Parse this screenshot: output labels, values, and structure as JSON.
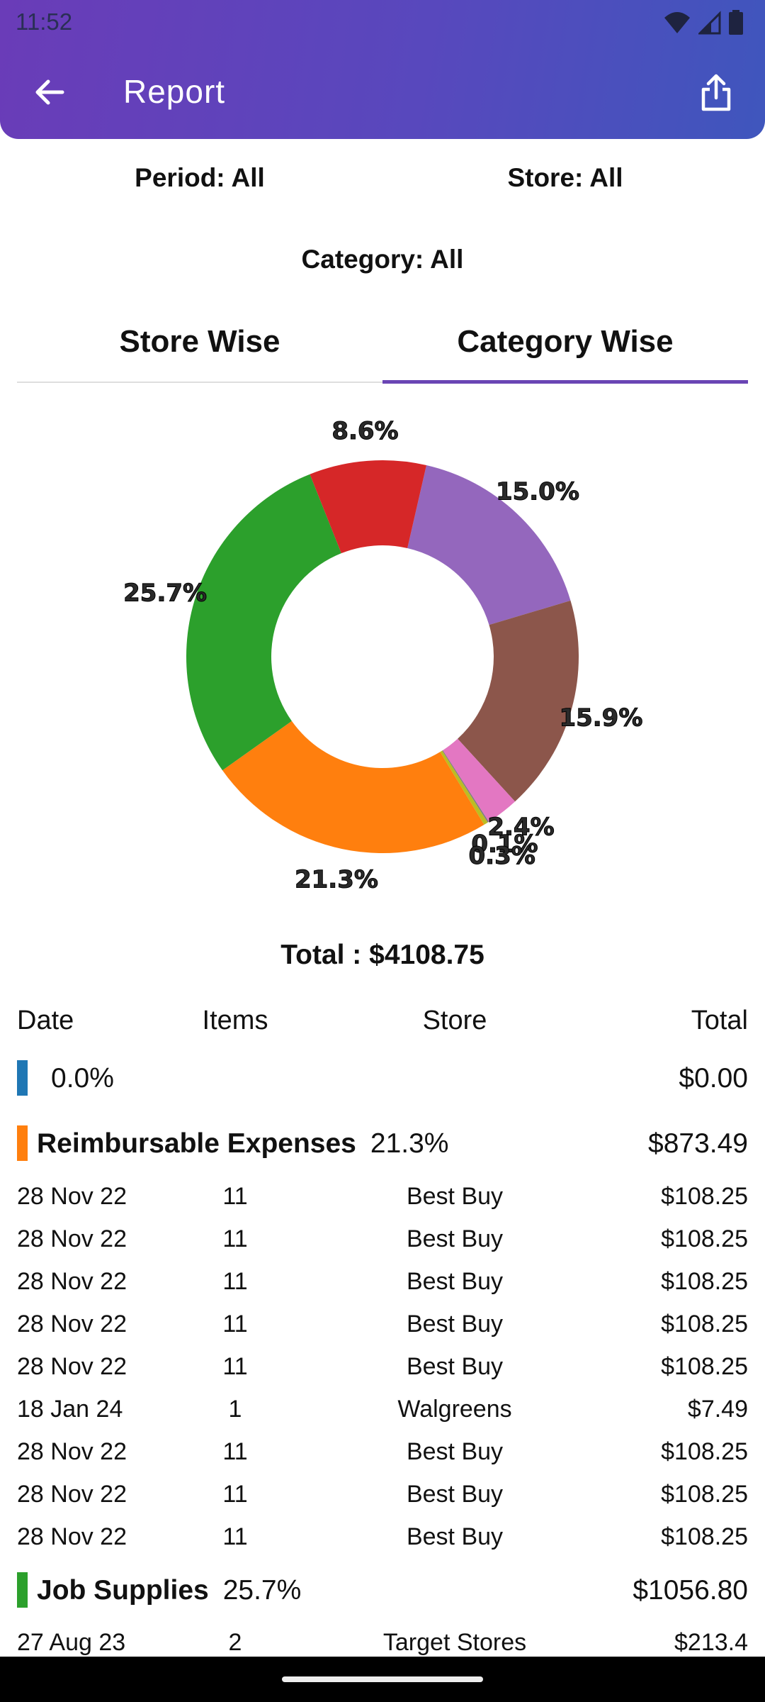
{
  "status": {
    "time": "11:52"
  },
  "toolbar": {
    "title": "Report"
  },
  "filters": {
    "period": "Period: All",
    "store": "Store: All",
    "category": "Category: All"
  },
  "tabs": [
    {
      "label": "Store Wise",
      "selected": false
    },
    {
      "label": "Category Wise",
      "selected": true
    }
  ],
  "chart_data": {
    "type": "pie",
    "donut": true,
    "slices": [
      {
        "label": "15.0%",
        "value": 15.0,
        "color": "#9467bd"
      },
      {
        "label": "15.9%",
        "value": 15.9,
        "color": "#8c564b"
      },
      {
        "label": "2.4%",
        "value": 2.4,
        "color": "#e377c2"
      },
      {
        "label": "0.1%",
        "value": 0.1,
        "color": "#7f7f7f"
      },
      {
        "label": "0.3%",
        "value": 0.3,
        "color": "#bcbd22"
      },
      {
        "label": "21.3%",
        "value": 21.3,
        "color": "#ff7f0e"
      },
      {
        "label": "25.7%",
        "value": 25.7,
        "color": "#2ca02c"
      },
      {
        "label": "8.6%",
        "value": 8.6,
        "color": "#d62728"
      }
    ]
  },
  "total_label": "Total : $4108.75",
  "table": {
    "headers": [
      "Date",
      "Items",
      "Store",
      "Total"
    ],
    "groups": [
      {
        "name": "",
        "percent": "0.0%",
        "total": "$0.00",
        "color": "#1f77b4",
        "rows": []
      },
      {
        "name": "Reimbursable Expenses",
        "percent": "21.3%",
        "total": "$873.49",
        "color": "#ff7f0e",
        "rows": [
          [
            "28 Nov 22",
            "11",
            "Best Buy",
            "$108.25"
          ],
          [
            "28 Nov 22",
            "11",
            "Best Buy",
            "$108.25"
          ],
          [
            "28 Nov 22",
            "11",
            "Best Buy",
            "$108.25"
          ],
          [
            "28 Nov 22",
            "11",
            "Best Buy",
            "$108.25"
          ],
          [
            "28 Nov 22",
            "11",
            "Best Buy",
            "$108.25"
          ],
          [
            "18 Jan 24",
            "1",
            "Walgreens",
            "$7.49"
          ],
          [
            "28 Nov 22",
            "11",
            "Best Buy",
            "$108.25"
          ],
          [
            "28 Nov 22",
            "11",
            "Best Buy",
            "$108.25"
          ],
          [
            "28 Nov 22",
            "11",
            "Best Buy",
            "$108.25"
          ]
        ]
      },
      {
        "name": "Job Supplies",
        "percent": "25.7%",
        "total": "$1056.80",
        "color": "#2ca02c",
        "rows": [
          [
            "27 Aug 23",
            "2",
            "Target Stores",
            "$213.4"
          ]
        ]
      }
    ]
  }
}
